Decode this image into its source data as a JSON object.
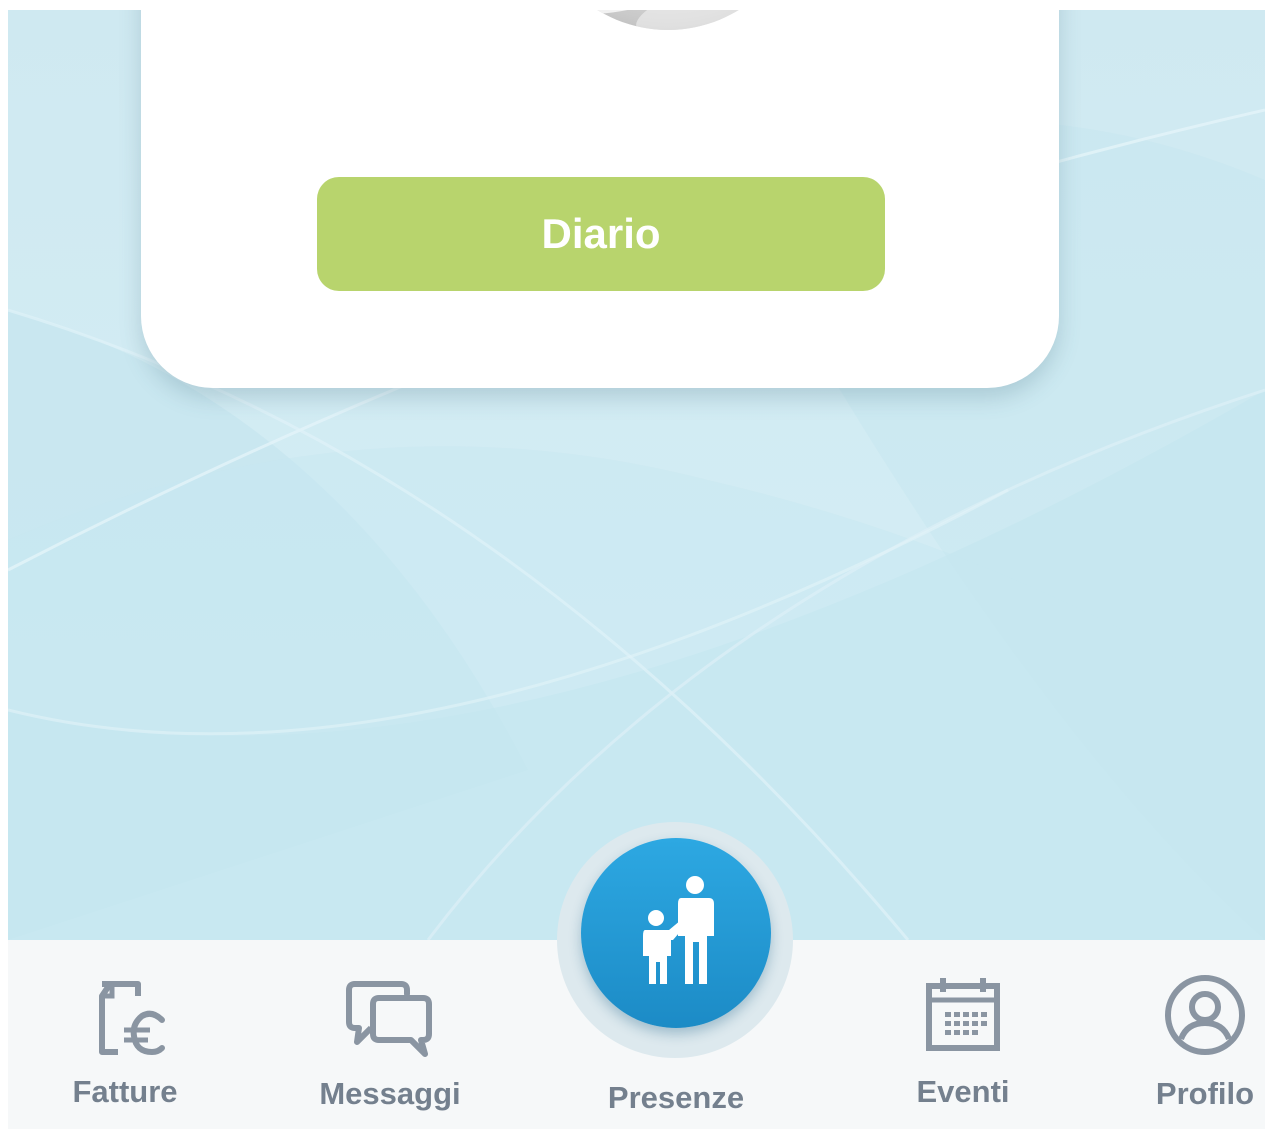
{
  "card": {
    "button_label": "Diario"
  },
  "tabs": [
    {
      "label": "Fatture",
      "icon": "invoice-euro-icon"
    },
    {
      "label": "Messaggi",
      "icon": "chat-bubbles-icon"
    },
    {
      "label": "Presenze",
      "icon": "parent-child-icon",
      "active": true
    },
    {
      "label": "Eventi",
      "icon": "calendar-icon"
    },
    {
      "label": "Profilo",
      "icon": "user-circle-icon"
    }
  ],
  "colors": {
    "button_green": "#b8d46d",
    "accent_blue": "#1e96d6",
    "tab_gray": "#74808e",
    "icon_gray": "#8a95a2",
    "background": "#cde9f1"
  }
}
